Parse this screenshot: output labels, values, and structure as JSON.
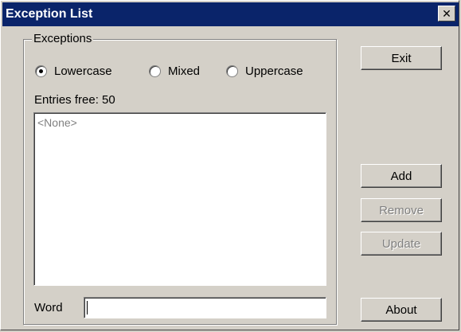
{
  "window": {
    "title": "Exception List",
    "close_glyph": "✕"
  },
  "exceptions": {
    "group_label": "Exceptions",
    "radios": [
      {
        "label": "Lowercase",
        "checked": true
      },
      {
        "label": "Mixed",
        "checked": false
      },
      {
        "label": "Uppercase",
        "checked": false
      }
    ],
    "entries_free": "Entries free: 50",
    "list_placeholder": "<None>",
    "word_label": "Word",
    "word_value": ""
  },
  "buttons": {
    "exit": "Exit",
    "add": "Add",
    "remove": "Remove",
    "update": "Update",
    "about": "About"
  }
}
